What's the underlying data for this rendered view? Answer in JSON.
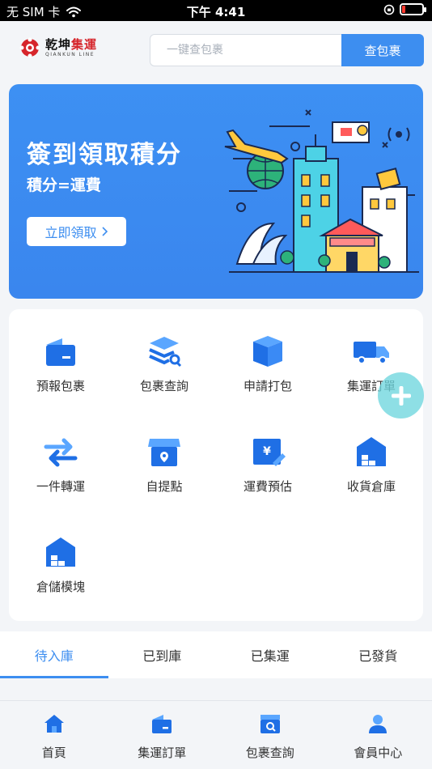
{
  "status_bar": {
    "carrier": "无 SIM 卡",
    "time": "下午 4:41"
  },
  "header": {
    "logo": {
      "cn_prefix": "乾坤",
      "cn_accent": "集運",
      "en": "QIANKUN LINE"
    },
    "search": {
      "placeholder": "一键查包裹",
      "button": "查包裹"
    }
  },
  "banner": {
    "title": "簽到領取積分",
    "subtitle": "積分=運費",
    "button": "立即領取"
  },
  "services": [
    {
      "label": "預報包裹",
      "icon": "forecast-box-icon"
    },
    {
      "label": "包裹查詢",
      "icon": "parcel-search-icon"
    },
    {
      "label": "申請打包",
      "icon": "package-box-icon"
    },
    {
      "label": "集運訂單",
      "icon": "truck-icon"
    },
    {
      "label": "一件轉運",
      "icon": "transfer-arrows-icon"
    },
    {
      "label": "自提點",
      "icon": "store-pickup-icon"
    },
    {
      "label": "運費預估",
      "icon": "fee-estimate-icon"
    },
    {
      "label": "收貨倉庫",
      "icon": "warehouse-icon"
    },
    {
      "label": "倉儲模塊",
      "icon": "storage-module-icon"
    }
  ],
  "tabs": [
    {
      "label": "待入庫",
      "active": true
    },
    {
      "label": "已到庫",
      "active": false
    },
    {
      "label": "已集運",
      "active": false
    },
    {
      "label": "已發貨",
      "active": false
    }
  ],
  "bottom_nav": [
    {
      "label": "首頁",
      "icon": "home-icon"
    },
    {
      "label": "集運訂單",
      "icon": "order-icon"
    },
    {
      "label": "包裹查詢",
      "icon": "parcel-search-icon"
    },
    {
      "label": "會員中心",
      "icon": "user-icon"
    }
  ],
  "colors": {
    "primary": "#3d8ef0",
    "banner": "#3a86ee",
    "fab": "#6ed6de",
    "logo_red": "#d6252b"
  }
}
